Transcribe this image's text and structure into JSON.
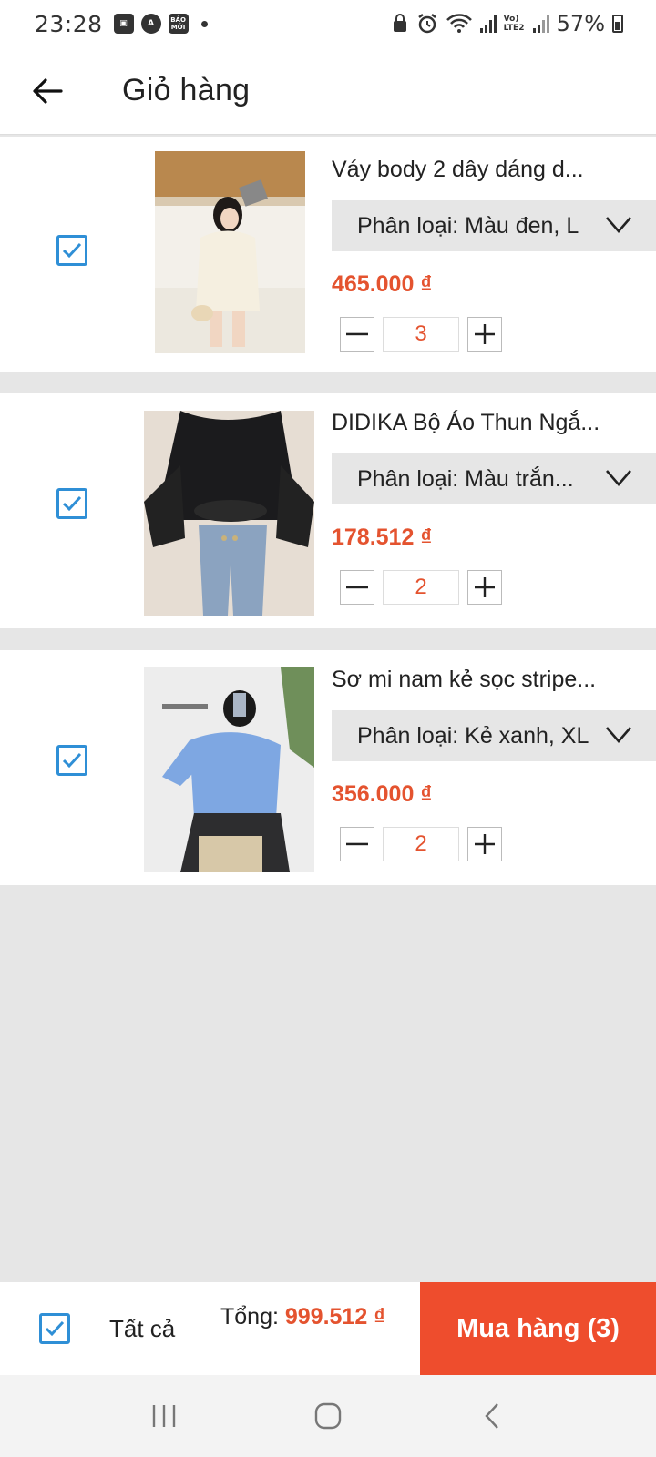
{
  "status_bar": {
    "time": "23:28",
    "notif_icons": [
      "image-icon",
      "a-icon",
      "baomoi-icon"
    ],
    "baomoi_label": "BÁO MỚI",
    "signal_label": "Vo) LTE2",
    "battery": "57%"
  },
  "header": {
    "title": "Giỏ hàng"
  },
  "cart": {
    "items": [
      {
        "title": "Váy body 2 dây dáng d...",
        "variant": "Phân loại: Màu đen, L",
        "price": "465.000 ₫",
        "quantity": "3",
        "checked": true
      },
      {
        "title": "DIDIKA Bộ Áo Thun Ngắ...",
        "variant": "Phân loại: Màu trắn...",
        "price": "178.512 ₫",
        "quantity": "2",
        "checked": true
      },
      {
        "title": "Sơ mi nam kẻ sọc stripe...",
        "variant": "Phân loại: Kẻ xanh, XL",
        "price": "356.000 ₫",
        "quantity": "2",
        "checked": true
      }
    ]
  },
  "checkout": {
    "select_all_label": "Tất cả",
    "total_label": "Tổng: ",
    "total_value": "999.512 ₫",
    "buy_label": "Mua hàng (3)"
  },
  "colors": {
    "accent": "#ee4d2d",
    "price": "#e4532f",
    "checkbox": "#2f8fd6"
  }
}
